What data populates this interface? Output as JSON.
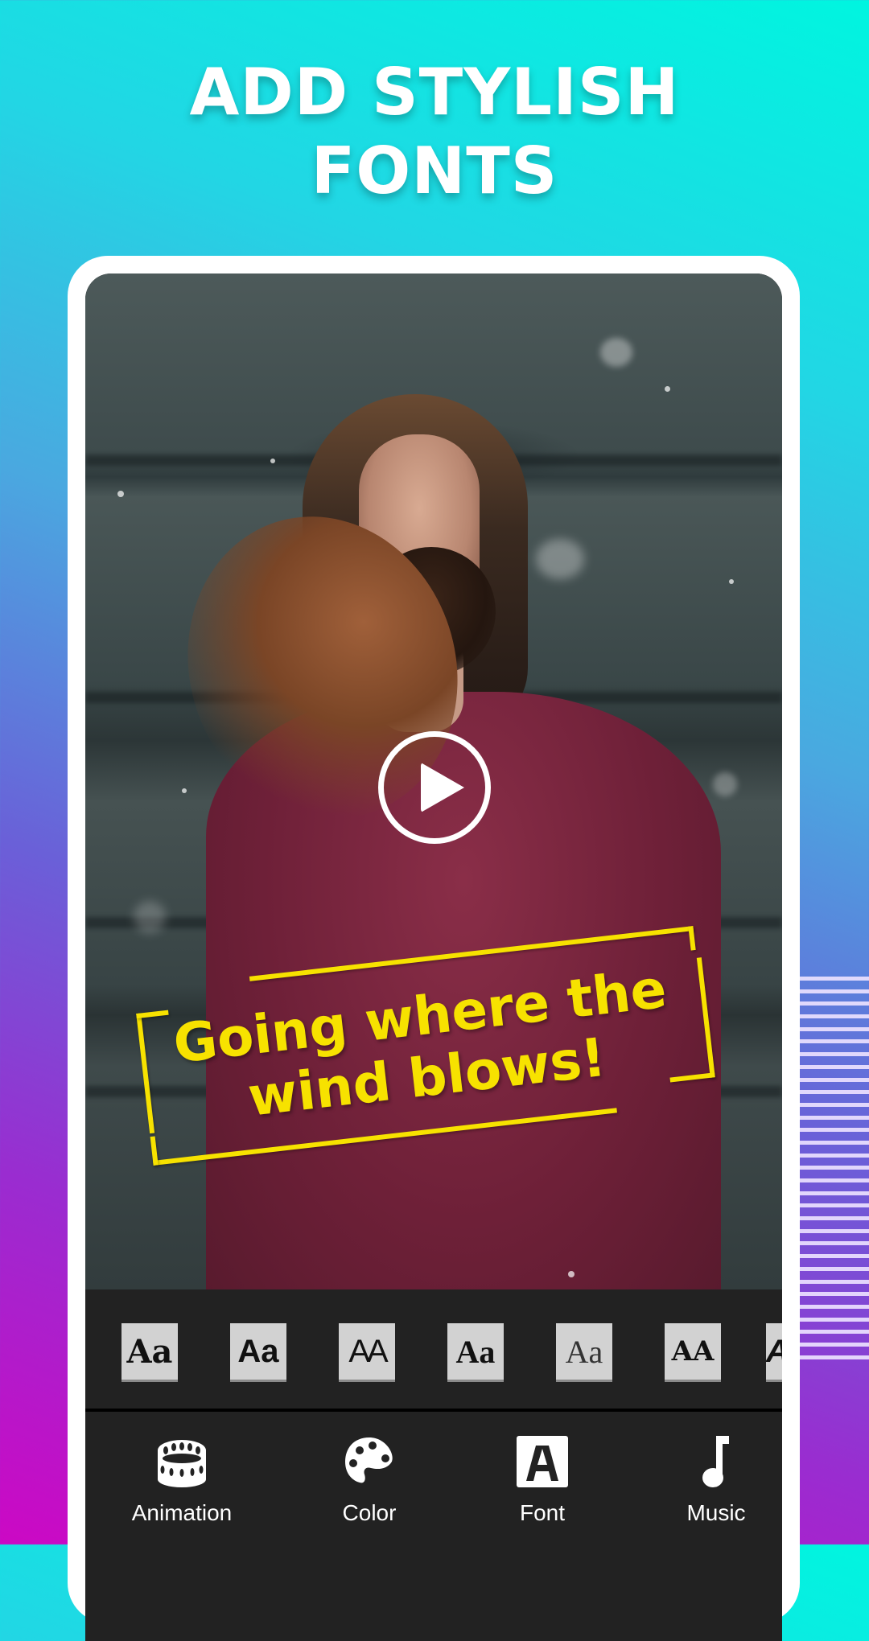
{
  "headline": {
    "line1": "ADD STYLISH",
    "line2": "FONTS"
  },
  "preview": {
    "caption_line1": "Going where the",
    "caption_line2": "wind blows!",
    "caption_color": "#f7e200",
    "play_icon": "play-circle-icon"
  },
  "font_strip": {
    "samples": [
      {
        "label": "Aa",
        "style": "serif-bold"
      },
      {
        "label": "Aa",
        "style": "sans-bold"
      },
      {
        "label": "AA",
        "style": "condensed-thin"
      },
      {
        "label": "Aa",
        "style": "serif-black"
      },
      {
        "label": "Aa",
        "style": "serif-light"
      },
      {
        "label": "AA",
        "style": "serif-caps"
      },
      {
        "label": "A",
        "style": "italic-partial"
      }
    ]
  },
  "nav": {
    "items": [
      {
        "label": "Animation",
        "icon": "animation-reel-icon"
      },
      {
        "label": "Color",
        "icon": "palette-icon"
      },
      {
        "label": "Font",
        "icon": "font-a-icon"
      },
      {
        "label": "Music",
        "icon": "music-note-icon"
      }
    ]
  },
  "colors": {
    "accent_yellow": "#f7e200",
    "panel_bg": "#222222",
    "tile_bg": "#d2d2d2"
  }
}
